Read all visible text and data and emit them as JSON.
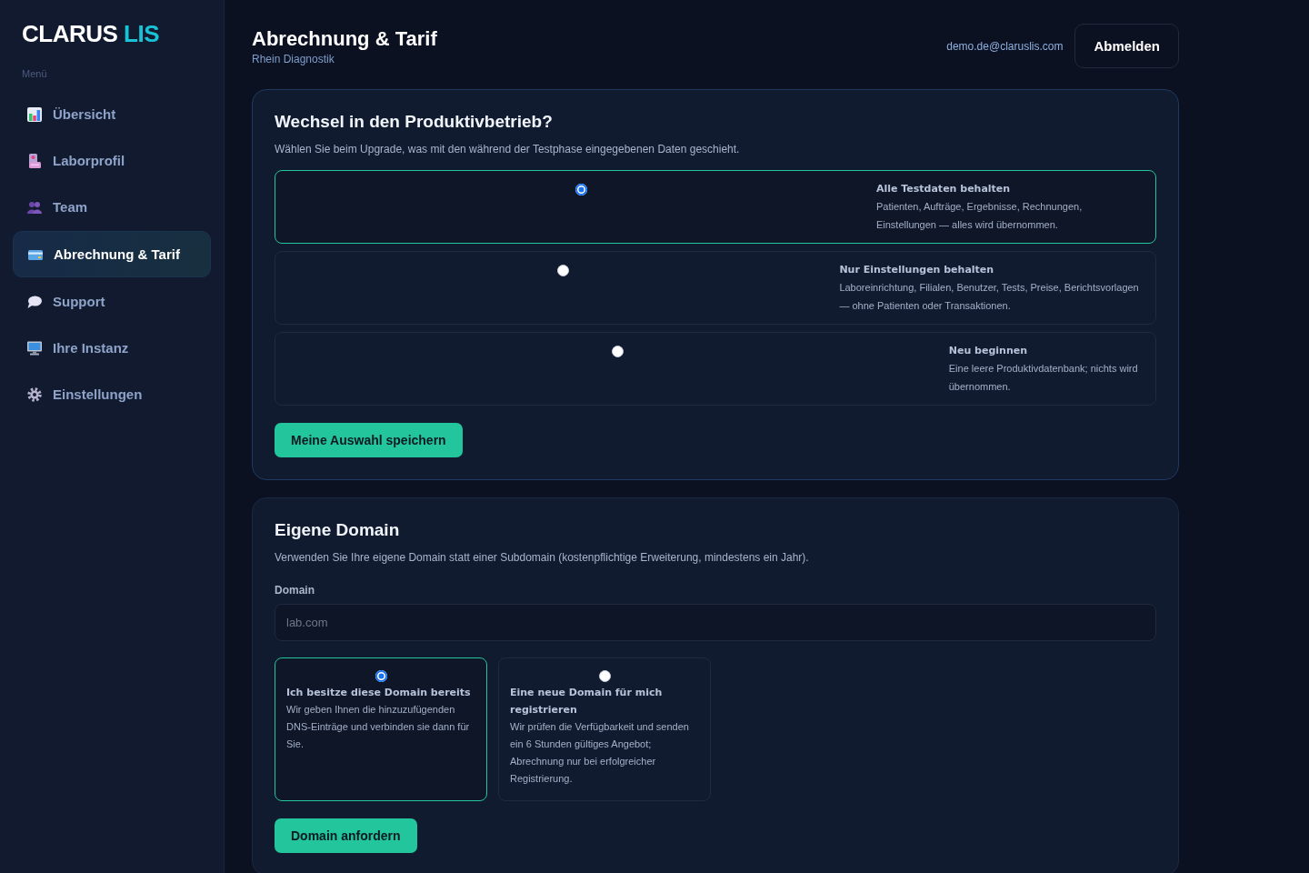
{
  "sidebar": {
    "logo": {
      "text": "CLARUS",
      "accent": "LIS"
    },
    "section_label": "Menü",
    "items": [
      {
        "label": "Übersicht",
        "selected": false
      },
      {
        "label": "Laborprofil",
        "selected": false
      },
      {
        "label": "Team",
        "selected": false
      },
      {
        "label": "Abrechnung & Tarif",
        "selected": true
      },
      {
        "label": "Support",
        "selected": false
      },
      {
        "label": "Ihre Instanz",
        "selected": false
      },
      {
        "label": "Einstellungen",
        "selected": false
      }
    ]
  },
  "header": {
    "title": "Abrechnung & Tarif",
    "subtitle": "Rhein Diagnostik",
    "email": "demo.de@claruslis.com",
    "logout_button": "Abmelden"
  },
  "upgrade_card": {
    "title": "Wechsel in den Produktivbetrieb?",
    "description": "Wählen Sie beim Upgrade, was mit den während der Testphase eingegebenen Daten geschieht.",
    "options": [
      {
        "title": "Alle Testdaten behalten",
        "description": "Patienten, Aufträge, Ergebnisse, Rechnungen, Einstellungen — alles wird übernommen.",
        "selected": true
      },
      {
        "title": "Nur Einstellungen behalten",
        "description": "Laboreinrichtung, Filialen, Benutzer, Tests, Preise, Berichtsvorlagen — ohne Patienten oder Transaktionen.",
        "selected": false
      },
      {
        "title": "Neu beginnen",
        "description": "Eine leere Produktivdatenbank; nichts wird übernommen.",
        "selected": false
      }
    ],
    "button": "Meine Auswahl speichern"
  },
  "domain_card": {
    "title": "Eigene Domain",
    "description": "Verwenden Sie Ihre eigene Domain statt einer Subdomain (kostenpflichtige Erweiterung, mindestens ein Jahr).",
    "field": {
      "label": "Domain",
      "placeholder": "lab.com"
    },
    "options": [
      {
        "title": "Ich besitze diese Domain bereits",
        "description": "Wir geben Ihnen die hinzuzufügenden DNS-Einträge und verbinden sie dann für Sie.",
        "selected": true
      },
      {
        "title": "Eine neue Domain für mich registrieren",
        "description": "Wir prüfen die Verfügbarkeit und senden ein 6 Stunden gültiges Angebot; Abrechnung nur bei erfolgreicher Registrierung.",
        "selected": false
      }
    ],
    "button": "Domain anfordern"
  }
}
